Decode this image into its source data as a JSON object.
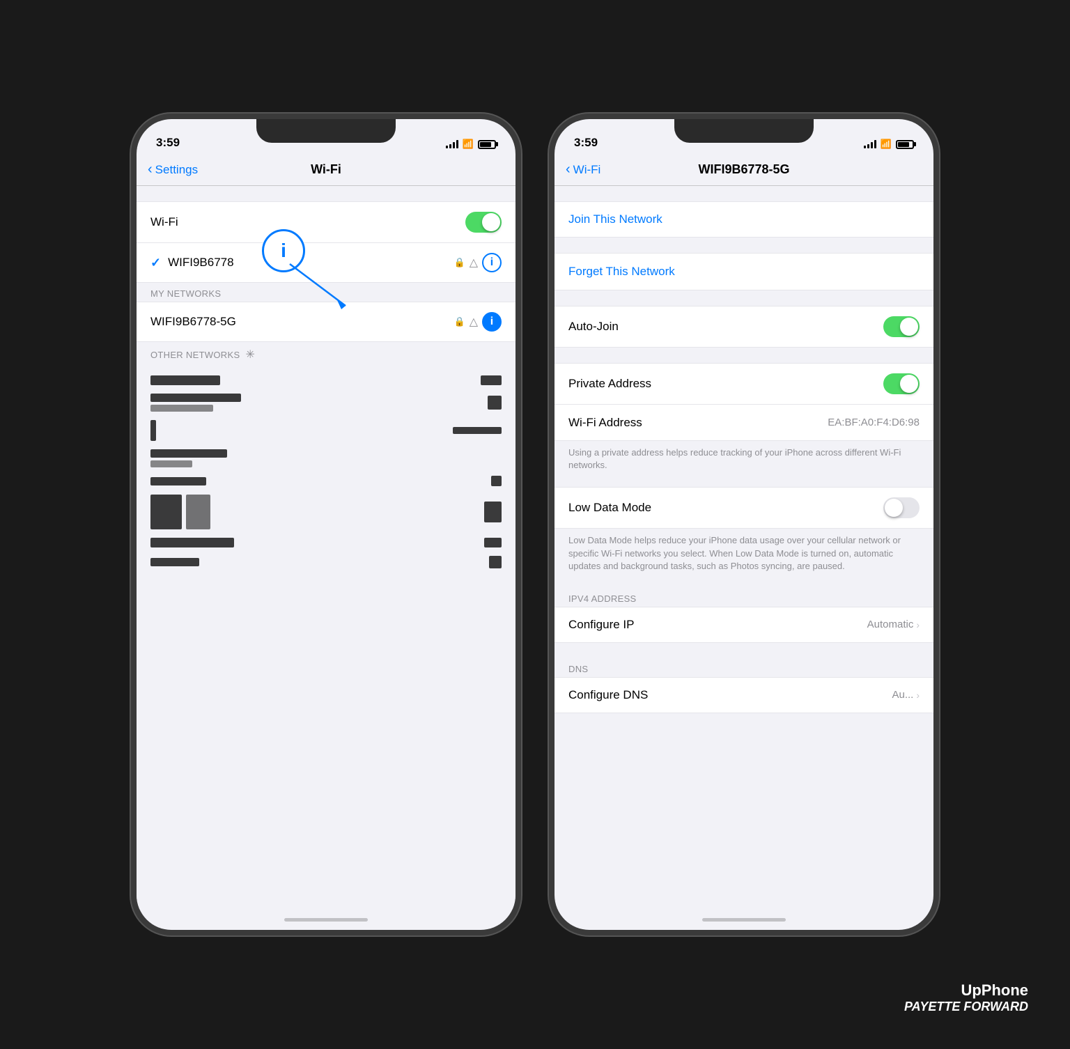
{
  "background_color": "#1a1a1a",
  "watermark": {
    "line1": "UpPhone",
    "line2": "PAYETTE FORWARD"
  },
  "left_phone": {
    "status_bar": {
      "time": "3:59",
      "signal": "full",
      "wifi": true,
      "battery": "high"
    },
    "nav": {
      "back_label": "Settings",
      "title": "Wi-Fi"
    },
    "wifi_toggle_label": "Wi-Fi",
    "wifi_toggle_on": true,
    "connected_network": "WIFI9B6778",
    "my_networks_section": "MY NETWORKS",
    "my_networks": [
      {
        "name": "WIFI9B6778-5G",
        "has_lock": true,
        "signal": "full",
        "has_info": true
      }
    ],
    "other_networks_section": "OTHER NETWORKS",
    "annotation": {
      "info_circle_label": "i",
      "arrow_direction": "down-right"
    }
  },
  "right_phone": {
    "status_bar": {
      "time": "3:59",
      "signal": "full",
      "wifi": true,
      "battery": "high"
    },
    "nav": {
      "back_label": "Wi-Fi",
      "title": "WIFI9B6778-5G"
    },
    "join_network_label": "Join This Network",
    "forget_network_label": "Forget This Network",
    "settings": [
      {
        "label": "Auto-Join",
        "type": "toggle",
        "value": true
      },
      {
        "label": "Private Address",
        "type": "toggle",
        "value": true
      },
      {
        "label": "Wi-Fi Address",
        "type": "value",
        "value": "EA:BF:A0:F4:D6:98"
      }
    ],
    "private_address_description": "Using a private address helps reduce tracking of your iPhone across different Wi-Fi networks.",
    "low_data_mode_label": "Low Data Mode",
    "low_data_mode_on": false,
    "low_data_description": "Low Data Mode helps reduce your iPhone data usage over your cellular network or specific Wi-Fi networks you select. When Low Data Mode is turned on, automatic updates and background tasks, such as Photos syncing, are paused.",
    "ipv4_section": "IPV4 ADDRESS",
    "configure_ip_label": "Configure IP",
    "configure_ip_value": "Automatic",
    "dns_section": "DNS",
    "configure_dns_label": "Configure DNS",
    "configure_dns_value": "Au..."
  }
}
